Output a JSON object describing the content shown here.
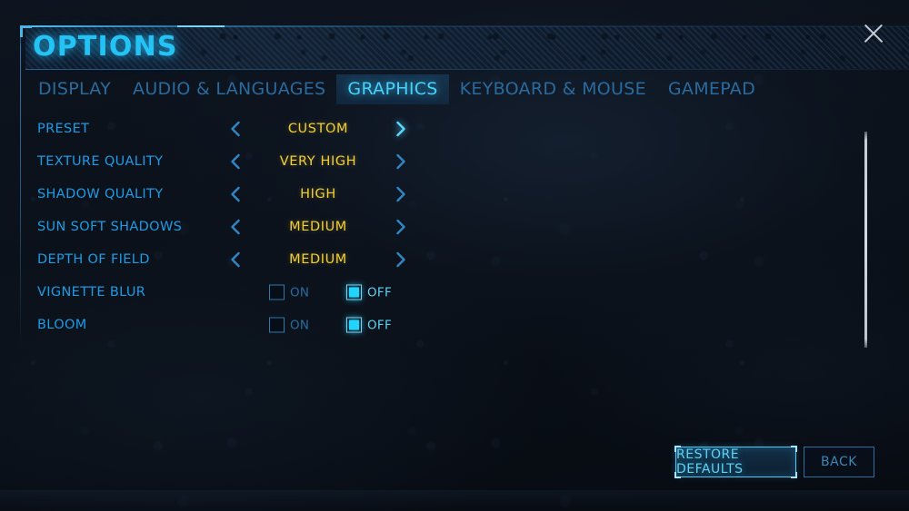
{
  "header": {
    "title": "OPTIONS",
    "close_icon": "close-x-icon",
    "accent_color": "#23c4f5"
  },
  "tabs": [
    {
      "label": "DISPLAY",
      "active": false
    },
    {
      "label": "AUDIO & LANGUAGES",
      "active": false
    },
    {
      "label": "GRAPHICS",
      "active": true
    },
    {
      "label": "KEYBOARD & MOUSE",
      "active": false
    },
    {
      "label": "GAMEPAD",
      "active": false
    }
  ],
  "settings": [
    {
      "label": "PRESET",
      "type": "stepper",
      "value": "CUSTOM",
      "left_icon": "chevron-left-icon",
      "right_icon": "chevron-right-icon",
      "right_highlighted": true
    },
    {
      "label": "TEXTURE QUALITY",
      "type": "stepper",
      "value": "VERY HIGH",
      "left_icon": "chevron-left-icon",
      "right_icon": "chevron-right-icon",
      "right_highlighted": false
    },
    {
      "label": "SHADOW QUALITY",
      "type": "stepper",
      "value": "HIGH",
      "left_icon": "chevron-left-icon",
      "right_icon": "chevron-right-icon",
      "right_highlighted": false
    },
    {
      "label": "SUN SOFT SHADOWS",
      "type": "stepper",
      "value": "MEDIUM",
      "left_icon": "chevron-left-icon",
      "right_icon": "chevron-right-icon",
      "right_highlighted": false
    },
    {
      "label": "DEPTH OF FIELD",
      "type": "stepper",
      "value": "MEDIUM",
      "left_icon": "chevron-left-icon",
      "right_icon": "chevron-right-icon",
      "right_highlighted": false
    },
    {
      "label": "VIGNETTE BLUR",
      "type": "checkbox",
      "on_label": "ON",
      "off_label": "OFF",
      "selected": "OFF"
    },
    {
      "label": "BLOOM",
      "type": "checkbox",
      "on_label": "ON",
      "off_label": "OFF",
      "selected": "OFF"
    }
  ],
  "buttons": {
    "restore": "RESTORE DEFAULTS",
    "back": "BACK"
  },
  "colors": {
    "label": "#1f9ae4",
    "value": "#f2cf36",
    "accent": "#23c4f5",
    "tab_inactive": "#2a6a9c",
    "checkbox_fill": "#22d3fb"
  }
}
